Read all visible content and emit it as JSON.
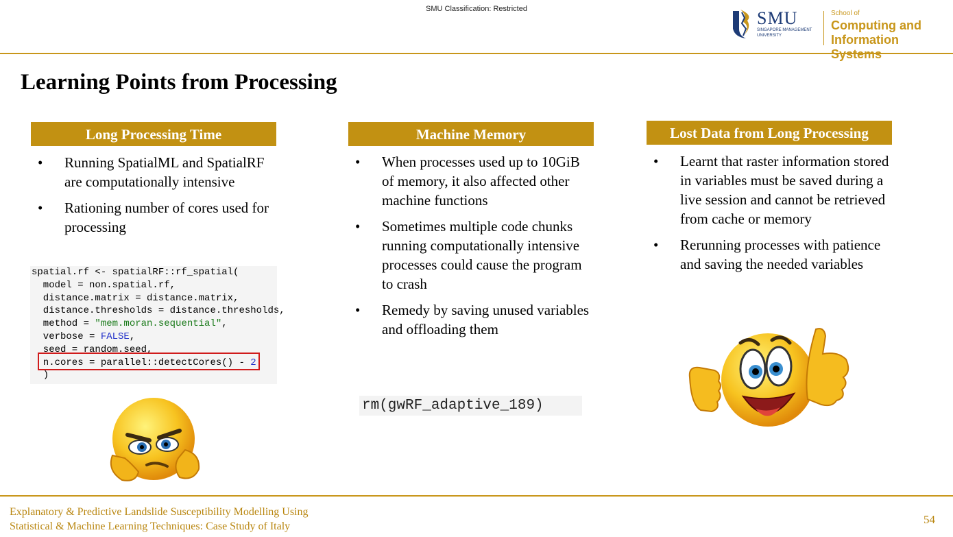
{
  "header": {
    "classification": "SMU Classification: Restricted",
    "logo": {
      "smu": "SMU",
      "smu_sub": "SINGAPORE MANAGEMENT UNIVERSITY",
      "school_of": "School of",
      "school_line1": "Computing and",
      "school_line2": "Information Systems"
    }
  },
  "slide": {
    "title": "Learning Points from Processing",
    "columns": [
      {
        "heading": "Long Processing Time",
        "bullets": [
          "Running SpatialML and SpatialRF are computationally intensive",
          "Rationing number of cores used for processing"
        ]
      },
      {
        "heading": "Machine Memory",
        "bullets": [
          "When processes used up to 10GiB of memory, it also affected other machine functions",
          "Sometimes multiple code chunks running computationally intensive processes could cause the program to crash",
          "Remedy by saving unused variables and offloading them"
        ]
      },
      {
        "heading": "Lost Data from Long Processing",
        "bullets": [
          "Learnt that raster information stored in variables must be saved during a live session and cannot be retrieved from cache or memory",
          "Rerunning processes with patience and saving the needed variables"
        ]
      }
    ],
    "bullet_glyph": "•",
    "code_snippet": {
      "l1": "spatial.rf <- spatialRF::rf_spatial(",
      "l2": "  model = non.spatial.rf,",
      "l3": "  distance.matrix = distance.matrix,",
      "l4": "  distance.thresholds = distance.thresholds,",
      "l5a": "  method = ",
      "l5b": "\"mem.moran.sequential\"",
      "l5c": ",",
      "l6a": "  verbose = ",
      "l6b": "FALSE",
      "l6c": ",",
      "l7": "  seed = random.seed,",
      "l8a": "  n.cores = parallel::detectCores() - ",
      "l8b": "2",
      "l9": "  )"
    },
    "rm_code": "rm(gwRF_adaptive_189)",
    "emojis": [
      "thinking-emoji",
      "thumbs-up-emoji"
    ]
  },
  "footer": {
    "line1": "Explanatory & Predictive Landslide Susceptibility Modelling Using",
    "line2": "Statistical & Machine Learning Techniques: Case Study of Italy",
    "page_number": "54"
  },
  "colors": {
    "accent_gold": "#c29112",
    "rule_gold": "#c8961a",
    "footer_text": "#b9860f",
    "smu_blue": "#1d3b76",
    "highlight_red": "#d01b1b"
  }
}
